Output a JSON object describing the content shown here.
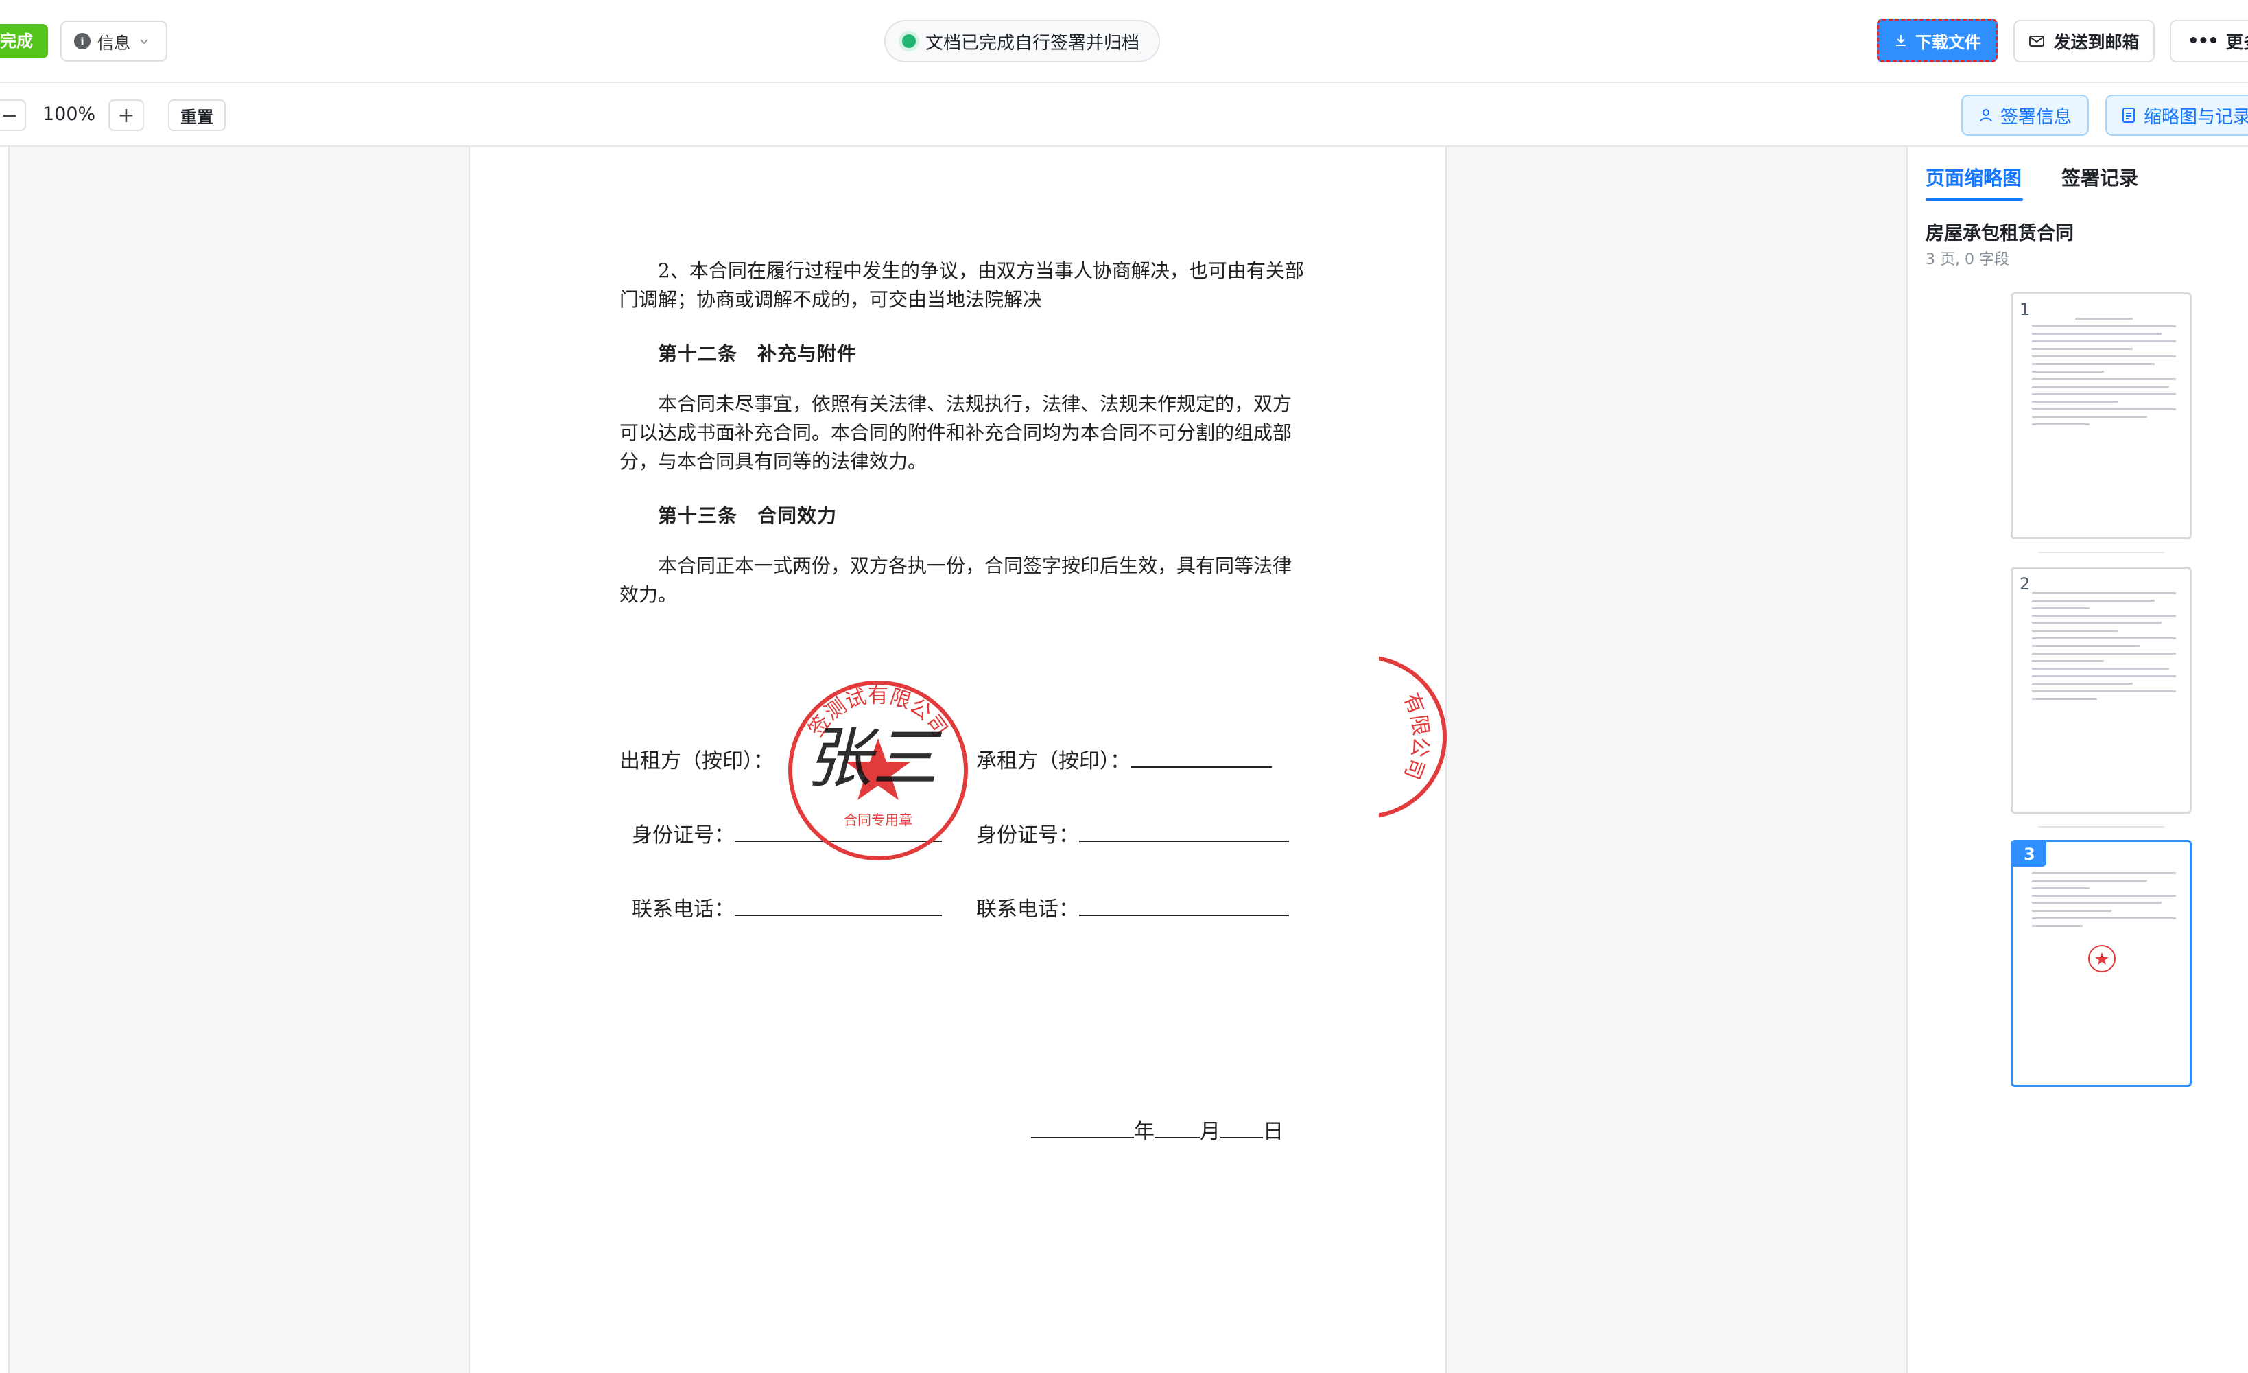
{
  "header": {
    "done_badge": "完成",
    "info_label": "信息",
    "status_text": "文档已完成自行签署并归档",
    "download_label": "下载文件",
    "email_label": "发送到邮箱",
    "more_label": "更多"
  },
  "toolbar": {
    "zoom_out_symbol": "−",
    "zoom_value": "100%",
    "zoom_in_symbol": "+",
    "reset_label": "重置",
    "sign_info_label": "签署信息",
    "thumb_records_label": "缩略图与记录"
  },
  "document": {
    "para_1": "2、本合同在履行过程中发生的争议，由双方当事人协商解决，也可由有关部门调解；协商或调解不成的，可交由当地法院解决",
    "heading_12": "第十二条　补充与附件",
    "para_2": "本合同未尽事宜，依照有关法律、法规执行，法律、法规未作规定的，双方可以达成书面补充合同。本合同的附件和补充合同均为本合同不可分割的组成部分，与本合同具有同等的法律效力。",
    "heading_13": "第十三条　合同效力",
    "para_3": "本合同正本一式两份，双方各执一份，合同签字按印后生效，具有同等法律效力。",
    "lessor_label": "出租方（按印）：",
    "lessee_label": "承租方（按印）：",
    "id_label_left": "身份证号：",
    "id_label_right": "身份证号：",
    "phone_label_left": "联系电话：",
    "phone_label_right": "联系电话：",
    "date_year": "年",
    "date_month": "月",
    "date_day": "日",
    "signature_text": "张三",
    "stamp_text": "签测试有限公司",
    "stamp_sub": "合同专用章",
    "stamp_edge_text": "有限公司"
  },
  "panel": {
    "tab_thumbnails": "页面缩略图",
    "tab_records": "签署记录",
    "doc_title": "房屋承包租赁合同",
    "doc_meta": "3 页, 0 字段",
    "pages": [
      {
        "num": "1"
      },
      {
        "num": "2"
      },
      {
        "num": "3"
      }
    ]
  },
  "colors": {
    "primary": "#1677ff",
    "download_bg": "#2f8fff",
    "done_green": "#52c41a",
    "status_dot": "#22b573",
    "stamp_red": "#e23b3b"
  }
}
